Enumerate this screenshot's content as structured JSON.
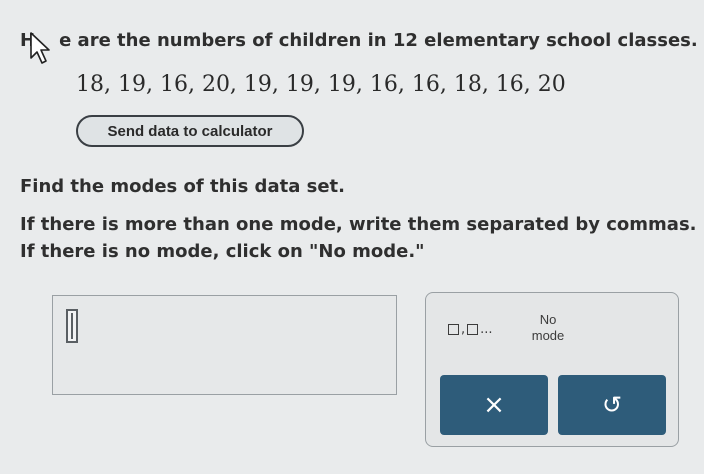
{
  "question": {
    "prompt_prefix": "H",
    "prompt_rest": "e are the numbers of children in 12 elementary school classes.",
    "data_values": "18, 19, 16, 20, 19, 19, 19, 16, 16, 18, 16, 20",
    "calculator_button": "Send data to calculator",
    "task": "Find the modes of this data set.",
    "instruction_line1": "If there is more than one mode, write them separated by commas.",
    "instruction_line2": "If there is no mode, click on \"No mode.\""
  },
  "answer_panel": {
    "multi_entry_dots": "...",
    "no_mode_label_line1": "No",
    "no_mode_label_line2": "mode",
    "clear_symbol": "×",
    "undo_symbol": "↺"
  },
  "colors": {
    "action_button": "#2e5c7a",
    "background": "#e9ebec"
  }
}
